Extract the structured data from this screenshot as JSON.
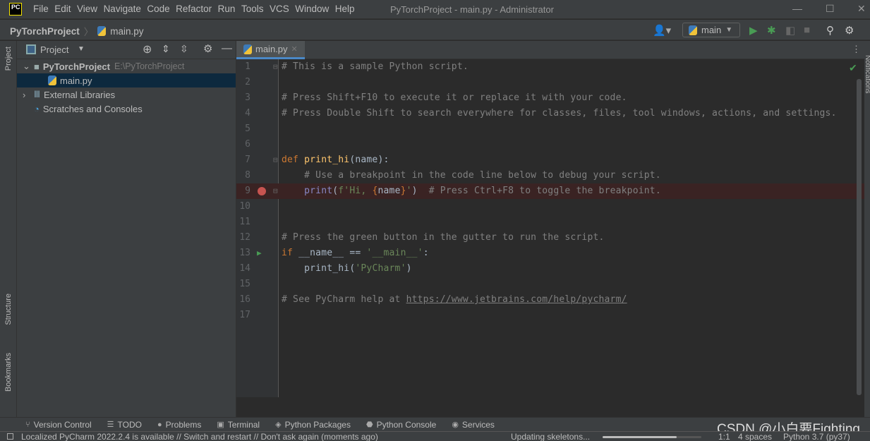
{
  "titlebar": {
    "logo": "PC",
    "menu": [
      "File",
      "Edit",
      "View",
      "Navigate",
      "Code",
      "Refactor",
      "Run",
      "Tools",
      "VCS",
      "Window",
      "Help"
    ],
    "title": "PyTorchProject - main.py - Administrator"
  },
  "navbar": {
    "project": "PyTorchProject",
    "file": "main.py",
    "run_config": "main"
  },
  "left_strip": {
    "project": "Project",
    "structure": "Structure",
    "bookmarks": "Bookmarks"
  },
  "project_panel": {
    "title": "Project",
    "tree": [
      {
        "label": "PyTorchProject",
        "path": "E:\\PyTorchProject",
        "icon": "folder-icon",
        "expanded": true
      },
      {
        "label": "main.py",
        "icon": "python-file-icon",
        "selected": true
      },
      {
        "label": "External Libraries",
        "icon": "library-icon"
      },
      {
        "label": "Scratches and Consoles",
        "icon": "scratches-icon"
      }
    ]
  },
  "editor": {
    "tab": "main.py",
    "lines": [
      [
        [
          "c",
          "# This is a sample Python script."
        ]
      ],
      [],
      [
        [
          "c",
          "# Press Shift+F10 to execute it or replace it with your code."
        ]
      ],
      [
        [
          "c",
          "# Press Double Shift to search everywhere for classes, files, tool windows, actions, and settings."
        ]
      ],
      [],
      [],
      [
        [
          "k",
          "def "
        ],
        [
          "f",
          "print_hi"
        ],
        [
          "n",
          "(name):"
        ]
      ],
      [
        [
          "c",
          "    # Use a breakpoint in the code line below to debug your script."
        ]
      ],
      [
        [
          "n",
          "    "
        ],
        [
          "b",
          "print"
        ],
        [
          "n",
          "("
        ],
        [
          "s",
          "f'Hi, "
        ],
        [
          "k",
          "{"
        ],
        [
          "n",
          "name"
        ],
        [
          "k",
          "}"
        ],
        [
          "s",
          "'"
        ],
        [
          "n",
          ")  "
        ],
        [
          "c",
          "# Press Ctrl+F8 to toggle the breakpoint."
        ]
      ],
      [],
      [],
      [
        [
          "c",
          "# Press the green button in the gutter to run the script."
        ]
      ],
      [
        [
          "k",
          "if "
        ],
        [
          "n",
          "__name__ == "
        ],
        [
          "s",
          "'__main__'"
        ],
        [
          "n",
          ":"
        ]
      ],
      [
        [
          "n",
          "    print_hi("
        ],
        [
          "s",
          "'PyCharm'"
        ],
        [
          "n",
          ")"
        ]
      ],
      [],
      [
        [
          "c",
          "# See PyCharm help at "
        ],
        [
          "u",
          "https://www.jetbrains.com/help/pycharm/"
        ]
      ],
      []
    ],
    "breakpoint_line": 9,
    "run_line": 13,
    "right_strip": "Notifications"
  },
  "bottom_tools": [
    "Version Control",
    "TODO",
    "Problems",
    "Terminal",
    "Python Packages",
    "Python Console",
    "Services"
  ],
  "status": {
    "message": "Localized PyCharm 2022.2.4 is available // Switch and restart // Don't ask again (moments ago)",
    "task": "Updating skeletons...",
    "progress": 0.75,
    "position": "1:1",
    "indent": "4 spaces",
    "interpreter": "Python 3.7 (py37)"
  },
  "watermark": "CSDN @小白要Fighting",
  "colors": {
    "accent": "#4a88c7",
    "run": "#499c54",
    "breakpoint": "#c75450"
  }
}
